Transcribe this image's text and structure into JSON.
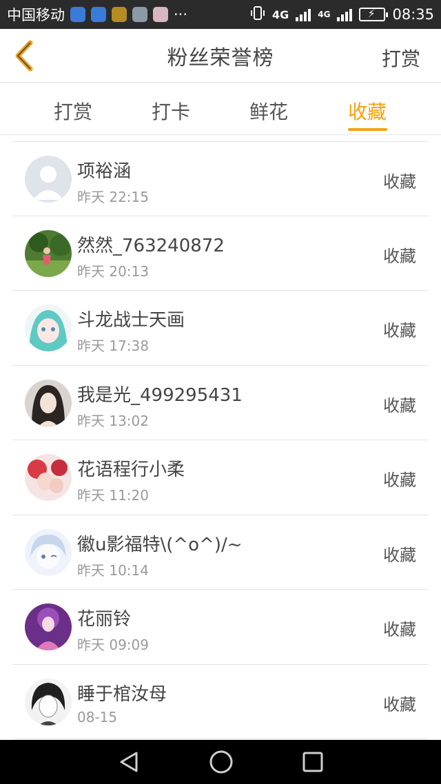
{
  "status_bar": {
    "carrier": "中国移动",
    "dots": "···",
    "network_1": "4G",
    "network_2": "4G",
    "time": "08:35"
  },
  "navbar": {
    "title": "粉丝荣誉榜",
    "right_label": "打赏"
  },
  "tabs": [
    {
      "label": "打赏"
    },
    {
      "label": "打卡"
    },
    {
      "label": "鲜花"
    },
    {
      "label": "收藏",
      "active": true
    }
  ],
  "list": [
    {
      "name": "项裕涵",
      "time": "昨天 22:15",
      "action": "收藏",
      "avatar": "default-avatar"
    },
    {
      "name": "然然_763240872",
      "time": "昨天 20:13",
      "action": "收藏",
      "avatar": "photo-avatar"
    },
    {
      "name": "斗龙战士天画",
      "time": "昨天 17:38",
      "action": "收藏",
      "avatar": "anime-avatar"
    },
    {
      "name": "我是光_499295431",
      "time": "昨天 13:02",
      "action": "收藏",
      "avatar": "portrait-avatar"
    },
    {
      "name": "花语程行小柔",
      "time": "昨天 11:20",
      "action": "收藏",
      "avatar": "anime-avatar"
    },
    {
      "name": "徽u影福特\\(^o^)/~",
      "time": "昨天 10:14",
      "action": "收藏",
      "avatar": "anime-avatar"
    },
    {
      "name": "花丽铃",
      "time": "昨天 09:09",
      "action": "收藏",
      "avatar": "anime-avatar"
    },
    {
      "name": "睡于棺汝母",
      "time": "08-15",
      "action": "收藏",
      "avatar": "sketch-avatar"
    }
  ],
  "colors": {
    "accent": "#f5a10f",
    "status_bar_bg": "#2b2b2b",
    "system_nav_bg": "#000000"
  }
}
